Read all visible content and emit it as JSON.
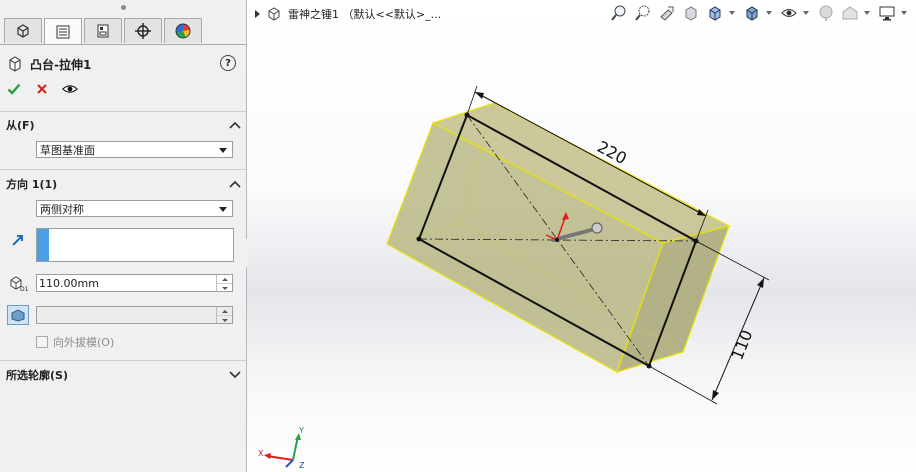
{
  "panel": {
    "feature_title": "凸台-拉伸1",
    "help": "?",
    "sections": {
      "from": {
        "title": "从(F)",
        "select": "草图基准面"
      },
      "direction1": {
        "title": "方向 1(1)",
        "select": "两侧对称",
        "depth": "110.00mm",
        "draft_label": "向外拔模(O)"
      },
      "contours": {
        "title": "所选轮廓(S)"
      }
    }
  },
  "viewport": {
    "breadcrumb": "雷神之锤1 （默认<<默认>_...",
    "dimensions": {
      "length": "220",
      "depth": "110"
    }
  },
  "triad": {
    "x": "X",
    "y": "Y",
    "z": "Z"
  },
  "colors": {
    "extrude_fill": "#b7b57e",
    "extrude_edge": "#e9e400",
    "accent_blue": "#4a9fe8",
    "accept": "#2f9e3c",
    "cancel": "#d1281f"
  }
}
